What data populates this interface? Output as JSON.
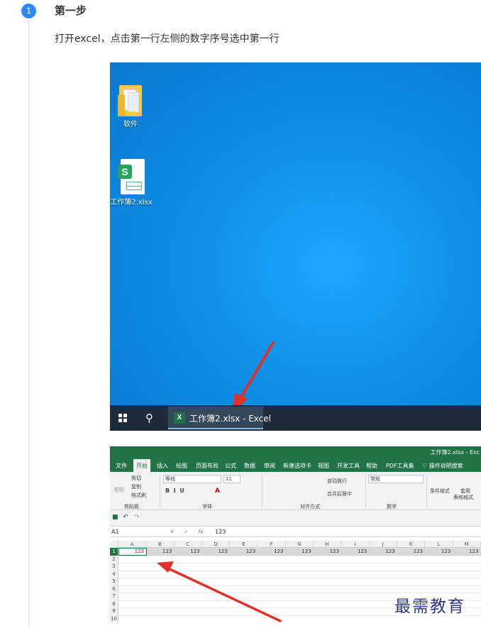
{
  "step": {
    "number": "1",
    "title": "第一步",
    "description": "打开excel，点击第一行左侧的数字序号选中第一行"
  },
  "desktop": {
    "icons": [
      {
        "label": "软件",
        "icon": "folder-icon"
      },
      {
        "label": "工作簿2.xlsx",
        "icon": "wps-spreadsheet-icon"
      }
    ],
    "taskbar": {
      "app_label": "工作簿2.xlsx - Excel"
    },
    "arrow_color": "#e0312b",
    "background": "#0e8fe8"
  },
  "excel": {
    "title": "工作簿2.xlsx  -  Exc",
    "tabs": [
      "文件",
      "开始",
      "插入",
      "绘图",
      "页面布局",
      "公式",
      "数据",
      "审阅",
      "新建选项卡",
      "视图",
      "开发工具",
      "帮助",
      "PDF工具集",
      "操作说明搜索"
    ],
    "active_tab": "开始",
    "ribbon": {
      "cut": "剪切",
      "copy": "复制",
      "format_painter": "格式刷",
      "paste": "粘贴",
      "clipboard": "剪贴板",
      "font_name": "等线",
      "font_size": "11",
      "font_group": "字体",
      "wrap_text": "自动换行",
      "merge_center": "合并后居中",
      "alignment_group": "对齐方式",
      "number_format": "常规",
      "number_group": "数字",
      "conditional_format": "条件格式",
      "table_format_1": "套用",
      "table_format_2": "表格格式"
    },
    "name_box": "A1",
    "formula_value": "123",
    "columns": [
      "A",
      "B",
      "C",
      "D",
      "E",
      "F",
      "G",
      "H",
      "I",
      "J",
      "K",
      "L",
      "M"
    ],
    "rows": [
      "1",
      "2",
      "3",
      "4",
      "5",
      "6",
      "7",
      "8",
      "9",
      "10"
    ],
    "row1_values": [
      "123",
      "123",
      "123",
      "123",
      "123",
      "123",
      "123",
      "123",
      "123",
      "123",
      "123",
      "123",
      "123"
    ],
    "accent": "#217346"
  },
  "watermark": "最需教育"
}
